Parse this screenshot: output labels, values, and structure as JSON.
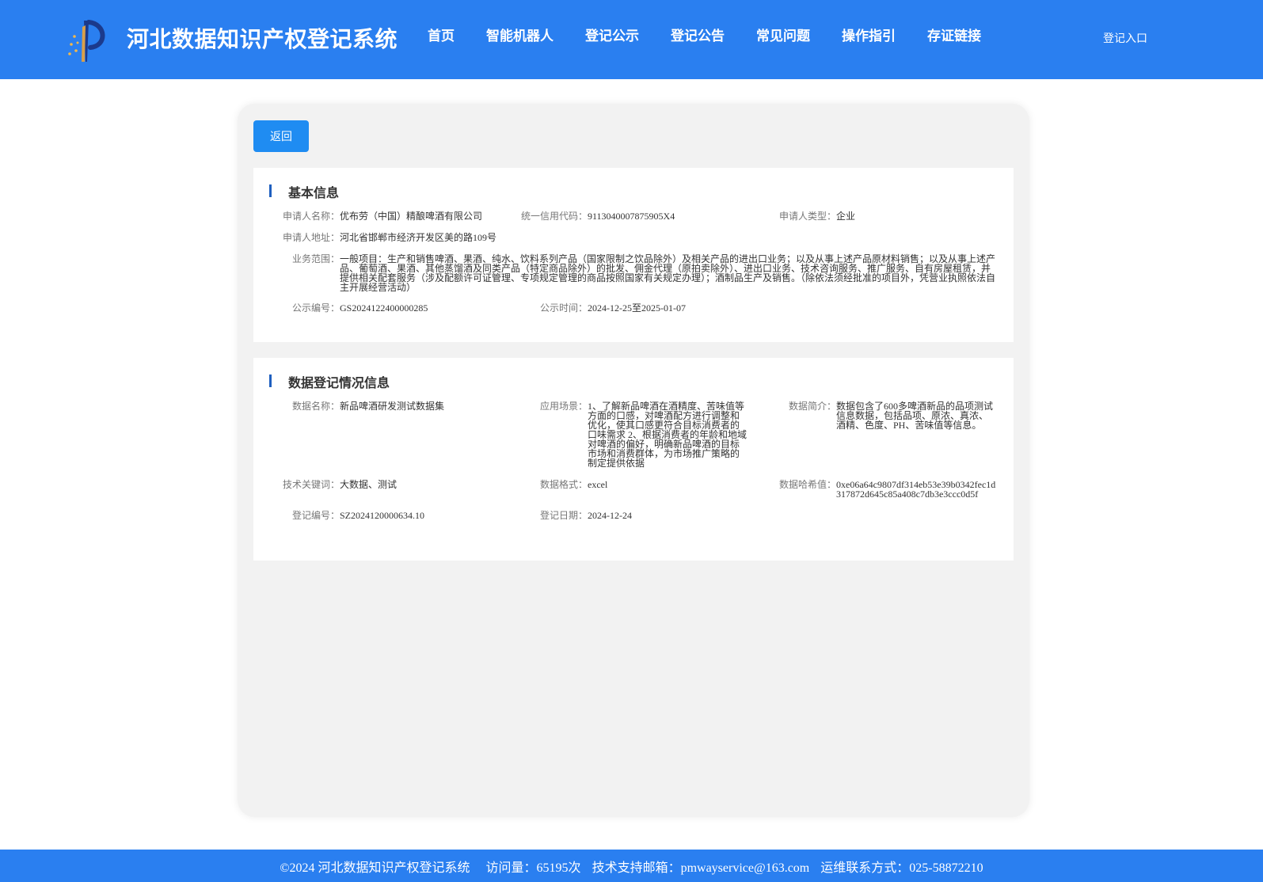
{
  "header": {
    "title": "河北数据知识产权登记系统",
    "nav": [
      "首页",
      "智能机器人",
      "登记公示",
      "登记公告",
      "常见问题",
      "操作指引",
      "存证链接"
    ],
    "login": "登记入口"
  },
  "back_label": "返回",
  "basic": {
    "title": "基本信息",
    "applicant_name_label": "申请人名称：",
    "applicant_name": "优布劳（中国）精酿啤酒有限公司",
    "credit_code_label": "统一信用代码：",
    "credit_code": "9113040007875905X4",
    "applicant_type_label": "申请人类型：",
    "applicant_type": "企业",
    "address_label": "申请人地址：",
    "address": "河北省邯郸市经济开发区美的路109号",
    "scope_label": "业务范围：",
    "scope": "一般项目：生产和销售啤酒、果酒、纯水、饮料系列产品（国家限制之饮品除外）及相关产品的进出口业务；以及从事上述产品原材料销售；以及从事上述产品、葡萄酒、果酒、其他蒸馏酒及同类产品（特定商品除外）的批发、佣金代理（原拍卖除外）、进出口业务、技术咨询服务、推广服务、自有房屋租赁，并提供相关配套服务（涉及配额许可证管理、专项规定管理的商品按照国家有关规定办理）；酒制品生产及销售。（除依法须经批准的项目外，凭营业执照依法自主开展经营活动）",
    "pub_no_label": "公示编号：",
    "pub_no": "GS2024122400000285",
    "pub_time_label": "公示时间：",
    "pub_time": "2024-12-25至2025-01-07"
  },
  "registration": {
    "title": "数据登记情况信息",
    "data_name_label": "数据名称：",
    "data_name": "新品啤酒研发测试数据集",
    "scenario_label": "应用场景：",
    "scenario": "1、了解新品啤酒在酒精度、苦味值等方面的口感，对啤酒配方进行调整和优化，使其口感更符合目标消费者的口味需求 2、根据消费者的年龄和地域对啤酒的偏好，明确新品啤酒的目标市场和消费群体，为市场推广策略的制定提供依据",
    "intro_label": "数据简介：",
    "intro": "数据包含了600多啤酒新品的品项测试信息数据，包括品项、原浓、真浓、酒精、色度、PH、苦味值等信息。",
    "keywords_label": "技术关键词：",
    "keywords": "大数据、测试",
    "format_label": "数据格式：",
    "format": "excel",
    "hash_label": "数据哈希值：",
    "hash": "0xe06a64c9807df314eb53e39b0342fec1d317872d645c85a408c7db3e3ccc0d5f",
    "reg_no_label": "登记编号：",
    "reg_no": "SZ2024120000634.10",
    "reg_date_label": "登记日期：",
    "reg_date": "2024-12-24"
  },
  "footer": {
    "copyright": "©2024 河北数据知识产权登记系统",
    "visits": "访问量：65195次",
    "email": "技术支持邮箱：pmwayservice@163.com",
    "phone": "运维联系方式：025-58872210"
  }
}
